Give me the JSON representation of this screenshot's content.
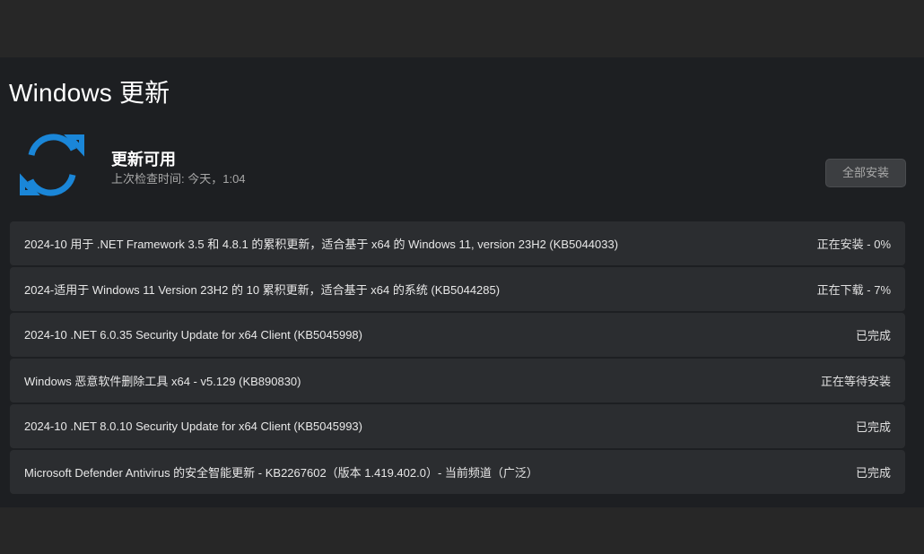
{
  "page": {
    "title": "Windows 更新"
  },
  "status": {
    "title": "更新可用",
    "last_check": "上次检查时间: 今天，1:04",
    "icon": "refresh-icon",
    "accent_color": "#1a86d8"
  },
  "actions": {
    "install_all_label": "全部安装"
  },
  "updates": [
    {
      "name": "2024-10 用于 .NET Framework 3.5 和 4.8.1 的累积更新，适合基于 x64 的 Windows 11, version 23H2 (KB5044033)",
      "status": "正在安装 - 0%"
    },
    {
      "name": "2024-适用于 Windows 11 Version 23H2 的 10 累积更新，适合基于 x64 的系统 (KB5044285)",
      "status": "正在下载 - 7%"
    },
    {
      "name": "2024-10 .NET 6.0.35 Security Update for x64 Client (KB5045998)",
      "status": "已完成"
    },
    {
      "name": "Windows 恶意软件删除工具 x64 - v5.129 (KB890830)",
      "status": "正在等待安装"
    },
    {
      "name": "2024-10 .NET 8.0.10 Security Update for x64 Client (KB5045993)",
      "status": "已完成"
    },
    {
      "name": "Microsoft Defender Antivirus 的安全智能更新 - KB2267602（版本 1.419.402.0）- 当前频道（广泛）",
      "status": "已完成"
    }
  ]
}
